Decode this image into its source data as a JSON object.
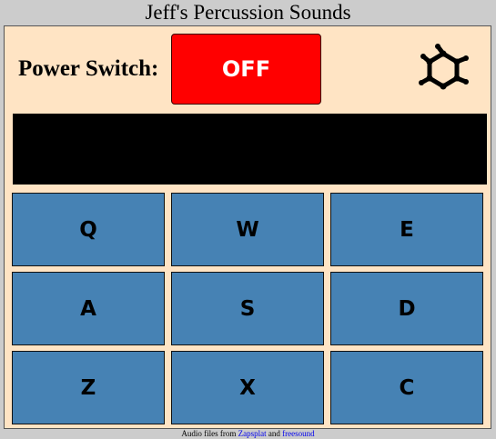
{
  "header": {
    "title": "Jeff's Percussion Sounds"
  },
  "controls": {
    "power_label": "Power Switch:",
    "power_button_label": "OFF",
    "power_state_color": "#ff0000",
    "logo_icon": "molecule-icon"
  },
  "display": {
    "text": ""
  },
  "pads": [
    {
      "key": "Q"
    },
    {
      "key": "W"
    },
    {
      "key": "E"
    },
    {
      "key": "A"
    },
    {
      "key": "S"
    },
    {
      "key": "D"
    },
    {
      "key": "Z"
    },
    {
      "key": "X"
    },
    {
      "key": "C"
    }
  ],
  "footer": {
    "prefix": "Audio files from ",
    "link1": "Zapsplat",
    "middle": " and ",
    "link2": "freesound"
  },
  "colors": {
    "background": "#cccccc",
    "panel": "#ffe4c4",
    "pad": "#4682b4",
    "display": "#000000",
    "link": "#0000ee"
  }
}
